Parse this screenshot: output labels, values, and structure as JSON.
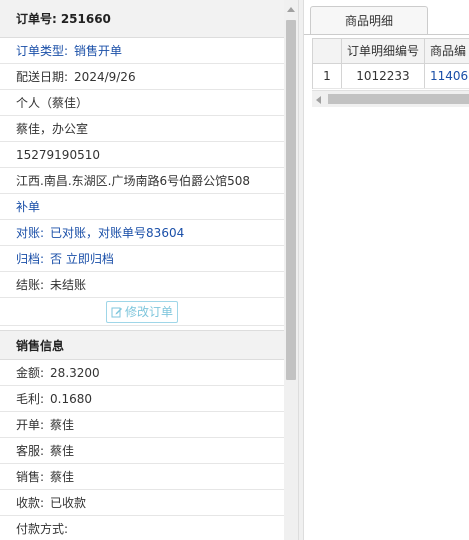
{
  "order": {
    "header_label": "订单号:",
    "number": "251660",
    "type_label": "订单类型:",
    "type_value": "销售开单",
    "delivery_label": "配送日期:",
    "delivery_date": "2024/9/26",
    "customer": "个人（蔡佳）",
    "contact": "蔡佳，办公室",
    "phone": "15279190510",
    "address": "江西.南昌.东湖区.广场南路6号伯爵公馆508",
    "supplement": "补单",
    "reconcile_label": "对账:",
    "reconcile_value": "已对账，对账单号83604",
    "archive_label": "归档:",
    "archive_value": "否 立即归档",
    "settle_label": "结账:",
    "settle_value": "未结账",
    "edit_button": "修改订单"
  },
  "sales": {
    "title": "销售信息",
    "rows": [
      {
        "label": "金额:",
        "value": "28.3200"
      },
      {
        "label": "毛利:",
        "value": "0.1680"
      },
      {
        "label": "开单:",
        "value": "蔡佳"
      },
      {
        "label": "客服:",
        "value": "蔡佳"
      },
      {
        "label": "销售:",
        "value": "蔡佳"
      },
      {
        "label": "收款:",
        "value": "已收款"
      },
      {
        "label": "付款方式:",
        "value": ""
      }
    ]
  },
  "details": {
    "tab_label": "商品明细",
    "columns": [
      "",
      "订单明细编号",
      "商品编"
    ],
    "rows": [
      {
        "index": "1",
        "detail_no": "1012233",
        "product_code": "11406"
      }
    ]
  },
  "colors": {
    "link_blue": "#1a4fa8",
    "edit_button_cyan": "#7fc6dc",
    "header_bg": "#f2f2f2"
  },
  "icons": {
    "edit_button_icon": "edit-icon",
    "scroll_up": "triangle-up-icon",
    "scroll_left": "triangle-left-icon"
  }
}
